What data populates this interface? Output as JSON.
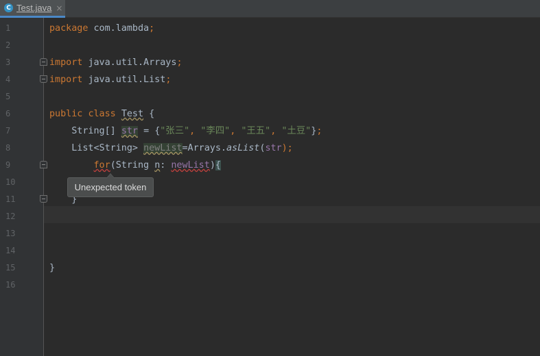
{
  "tab": {
    "icon_letter": "C",
    "filename": "Test.java",
    "close_glyph": "×"
  },
  "line_numbers": [
    "1",
    "2",
    "3",
    "4",
    "5",
    "6",
    "7",
    "8",
    "9",
    "10",
    "11",
    "12",
    "13",
    "14",
    "15",
    "16"
  ],
  "code": {
    "l1": {
      "package_kw": "package",
      "package_name": "com.lambda",
      "semi": ";"
    },
    "l3": {
      "import_kw": "import",
      "path": "java.util.Arrays",
      "semi": ";"
    },
    "l4": {
      "import_kw": "import",
      "path": "java.util.List",
      "semi": ";"
    },
    "l6": {
      "public_kw": "public",
      "class_kw": "class",
      "class_name": "Test",
      "brace": "{"
    },
    "l7": {
      "type": "String[]",
      "var": "str",
      "assign": "=",
      "open": "{",
      "s1": "\"张三\"",
      "s2": "\"李四\"",
      "s3": "\"王五\"",
      "s4": "\"土豆\"",
      "comma": ",",
      "close": "}",
      "semi": ";"
    },
    "l8": {
      "type": "List<String>",
      "var": "newList",
      "eq": "=Arrays.",
      "method": "asList",
      "open_paren": "(",
      "arg": "str",
      "close": ");"
    },
    "l9": {
      "for_kw": "for",
      "open_paren": "(",
      "type": "String",
      "var": "n",
      "colon": ":",
      "iter": "newList",
      "close_paren": ")",
      "brace": "{"
    },
    "l11": {
      "brace": "}"
    },
    "l15": {
      "brace": "}"
    }
  },
  "tooltip": {
    "text": "Unexpected token"
  },
  "colors": {
    "background": "#2b2b2b",
    "keyword": "#cc7832",
    "string": "#6a8759",
    "field": "#9876aa",
    "error": "#bc3f3c"
  }
}
